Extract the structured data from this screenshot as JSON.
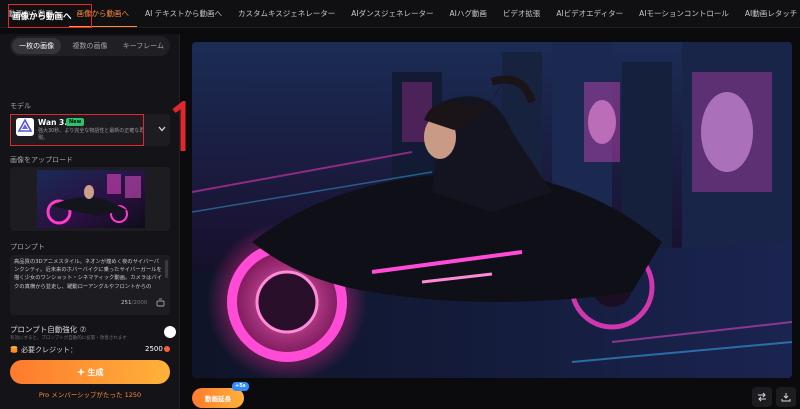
{
  "nav": {
    "tabs": [
      {
        "label": "動画から動画へ",
        "active": false
      },
      {
        "label": "画像から動画へ",
        "active": true
      },
      {
        "label": "AI テキストから動画へ",
        "active": false
      },
      {
        "label": "カスタムキスジェネレーター",
        "active": false
      },
      {
        "label": "AIダンスジェネレーター",
        "active": false
      },
      {
        "label": "AIハグ動画",
        "active": false
      },
      {
        "label": "ビデオ拡張",
        "active": false
      },
      {
        "label": "AIビデオエディター",
        "active": false
      },
      {
        "label": "AIモーションコントロール",
        "active": false
      },
      {
        "label": "AI動画レタッチ",
        "active": false
      }
    ]
  },
  "sidebar": {
    "title": "画像から動画へ",
    "modes": [
      {
        "label": "一枚の画像",
        "active": true
      },
      {
        "label": "複数の画像",
        "active": false
      },
      {
        "label": "キーフレーム",
        "active": false
      }
    ],
    "model_label": "モデル",
    "model": {
      "name": "Wan 3.0",
      "badge": "New",
      "description": "強大30秒、より完全な物語性と最新の正確な再現。"
    },
    "upload_label": "画像をアップロード",
    "prompt_label": "プロンプト",
    "prompt_text": "高品質の3Dアニメスタイル。ネオンが煌めく夜のサイバーパンクシティ。近未来のホバーバイクに乗ったサイバーガールを描く少女のワンショット・シネマティック動画。カメラはバイクの真横から並走し、躍動ローアングルやフロントからの",
    "char_count": "251",
    "char_max": "/2000",
    "auto_enhance_label": "プロンプト自動強化 ⑦",
    "auto_enhance_sub": "有効にすると、プロンプトが自動的に拡張・改善されます",
    "credits_label": "必要クレジット：",
    "credits_value": "2500",
    "generate_label": "生成",
    "pro_text": "Pro メンバーシップがたった 1250"
  },
  "annotation": {
    "step": "1"
  },
  "preview": {
    "extend_label": "動画延長",
    "extend_badge": "+5s"
  },
  "colors": {
    "accent": "#ff8a3c",
    "highlight_box": "#e2262b"
  }
}
